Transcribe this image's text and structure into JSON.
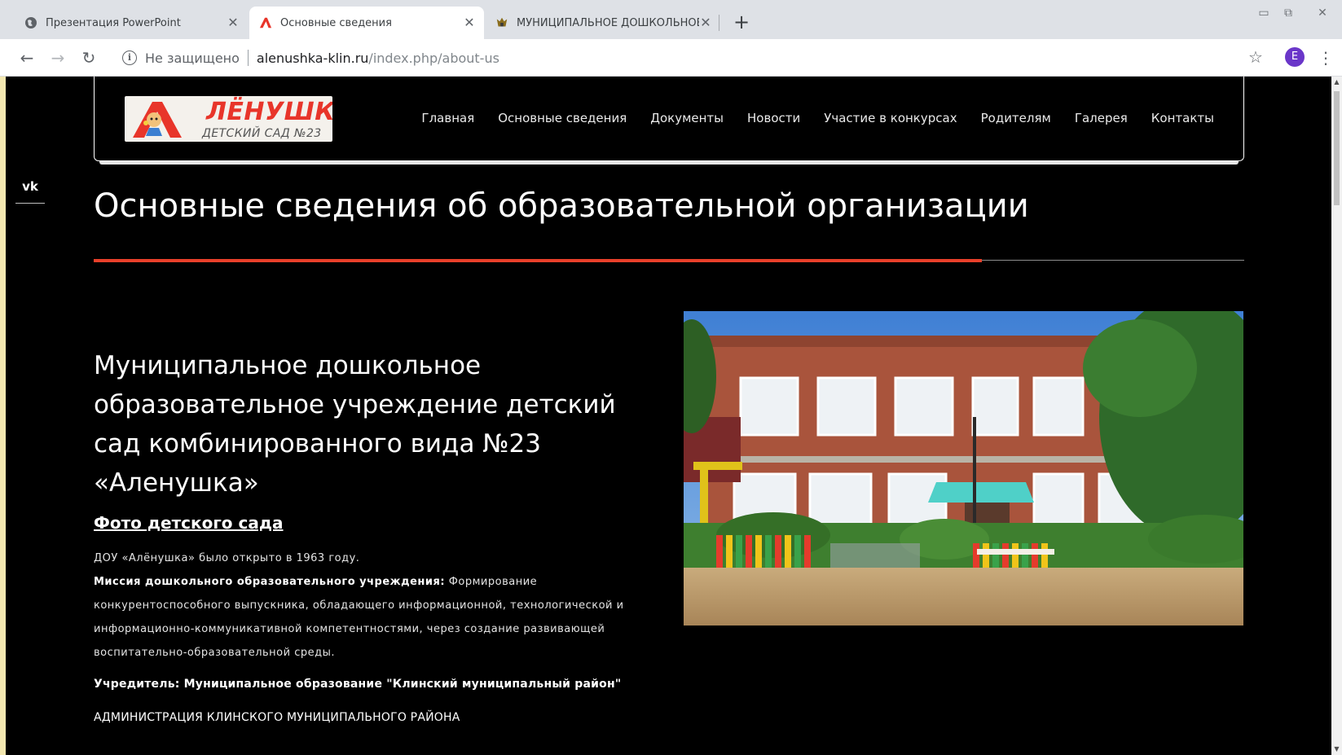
{
  "browser": {
    "tabs": [
      {
        "title": "Презентация PowerPoint",
        "active": false
      },
      {
        "title": "Основные сведения",
        "active": true
      },
      {
        "title": "МУНИЦИПАЛЬНОЕ ДОШКОЛЬНОЕ ",
        "active": false
      }
    ],
    "security_label": "Не защищено",
    "url_domain": "alenushka-klin.ru",
    "url_path": "/index.php/about-us",
    "profile_initial": "E",
    "profile_color": "#6a36c9"
  },
  "site": {
    "logo": {
      "name": "ЛЁНУШКА",
      "subtitle": "ДЕТСКИЙ САД №23",
      "letter": "А"
    },
    "menu": [
      "Главная",
      "Основные сведения",
      "Документы",
      "Новости",
      "Участие в конкурсах",
      "Родителям",
      "Галерея",
      "Контакты"
    ],
    "social": "vk",
    "page_title": "Основные сведения об образовательной организации",
    "org_name": "Муниципальное дошкольное образовательное учреждение  детский сад комбинированного вида №23 «Аленушка»",
    "photo_link": "Фото детского сада",
    "opened": "ДОУ «Алёнушка» было открыто в 1963 году.",
    "mission_label": "Миссия дошкольного образовательного учреждения:",
    "mission_text": " Формирование конкурентоспособного выпускника, обладающего информационной, технологической и информационно-коммуникативной компетентностями, через создание развивающей воспитательно-образовательной среды.",
    "founder": "Учредитель: Муниципальное образование \"Клинский муниципальный район\"",
    "admin": "АДМИНИСТРАЦИЯ КЛИНСКОГО МУНИЦИПАЛЬНОГО РАЙОНА",
    "colors": {
      "accent": "#e8402a",
      "background": "#000000"
    }
  }
}
